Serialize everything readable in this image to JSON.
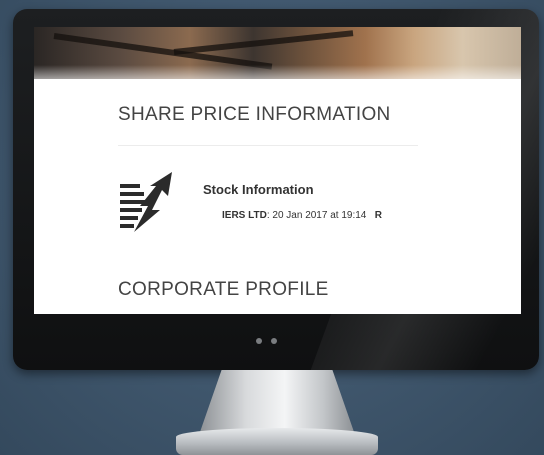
{
  "screen": {
    "sections": [
      {
        "title": "SHARE PRICE INFORMATION"
      },
      {
        "title": "CORPORATE PROFILE"
      }
    ],
    "stock": {
      "heading": "Stock Information",
      "company_fragment": "IERS LTD",
      "quote_text": ": 20 Jan 2017 at 19:14",
      "trailing_fragment": "R",
      "icon": "stock-chart-arrow-icon"
    }
  },
  "colors": {
    "background": "#3f566c",
    "bezel": "#1d1f21",
    "screen": "#ffffff",
    "heading_text": "#444444"
  }
}
